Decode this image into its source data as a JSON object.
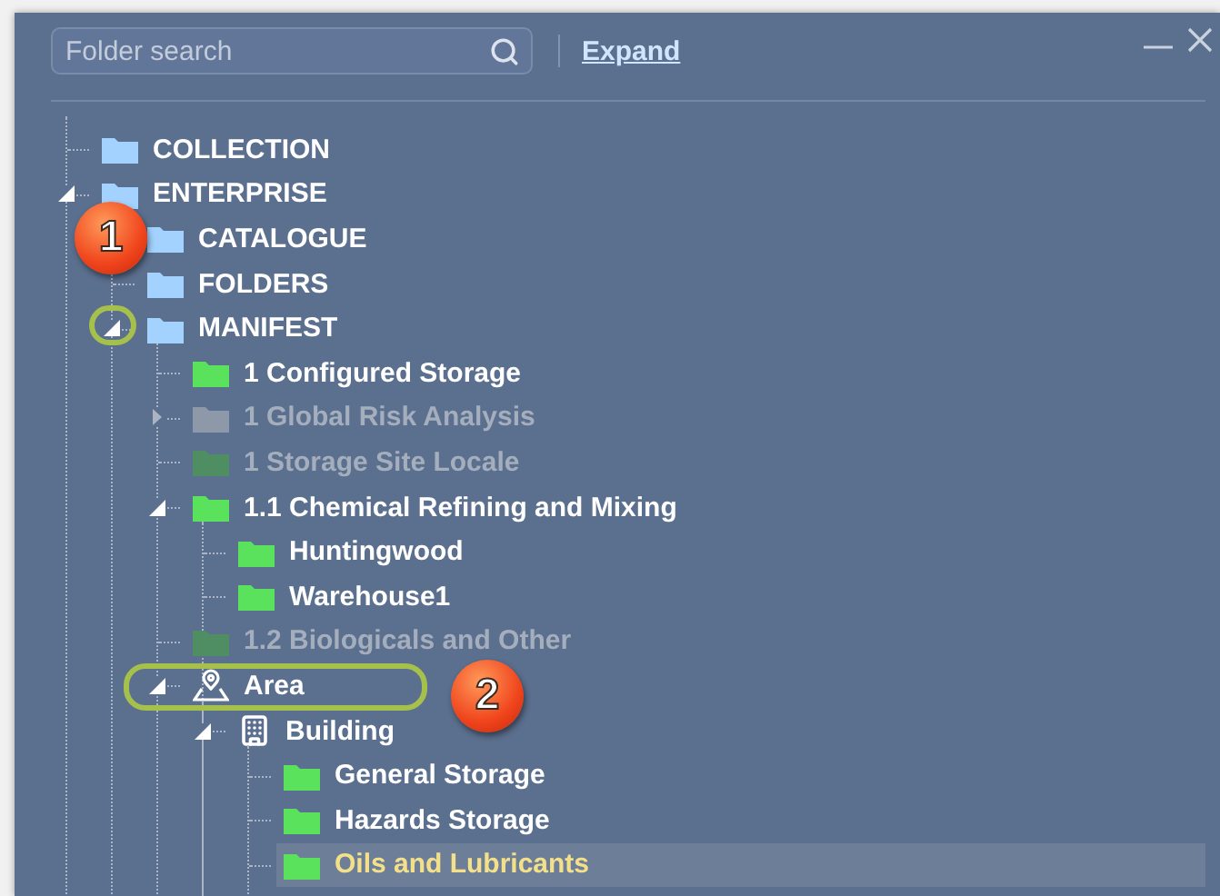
{
  "search": {
    "placeholder": "Folder search"
  },
  "expand_link": "Expand",
  "tree": [
    {
      "label": "COLLECTION",
      "kind": "folder",
      "color": "#a3d2ff",
      "disabled": false,
      "selected": false
    },
    {
      "label": "ENTERPRISE",
      "kind": "folder",
      "color": "#a3d2ff",
      "disabled": false,
      "selected": false,
      "expanded": true,
      "children": [
        {
          "label": "CATALOGUE",
          "kind": "folder",
          "color": "#a3d2ff",
          "disabled": false,
          "selected": false
        },
        {
          "label": "FOLDERS",
          "kind": "folder",
          "color": "#a3d2ff",
          "disabled": false,
          "selected": false
        },
        {
          "label": "MANIFEST",
          "kind": "folder",
          "color": "#a3d2ff",
          "disabled": false,
          "selected": false,
          "expanded": true,
          "children": [
            {
              "label": "1 Configured Storage",
              "kind": "folder",
              "color": "#5ae25c",
              "disabled": false,
              "selected": false
            },
            {
              "label": "1 Global Risk Analysis",
              "kind": "folder",
              "color": "#8d98a9",
              "disabled": true,
              "selected": false,
              "expanded": false
            },
            {
              "label": "1 Storage Site Locale",
              "kind": "folder",
              "color": "#4f8d62",
              "disabled": true,
              "selected": false
            },
            {
              "label": "1.1 Chemical Refining and Mixing",
              "kind": "folder",
              "color": "#5ae25c",
              "disabled": false,
              "selected": false,
              "expanded": true,
              "children": [
                {
                  "label": "Huntingwood",
                  "kind": "folder",
                  "color": "#5ae25c",
                  "disabled": false,
                  "selected": false
                },
                {
                  "label": "Warehouse1",
                  "kind": "folder",
                  "color": "#5ae25c",
                  "disabled": false,
                  "selected": false
                }
              ]
            },
            {
              "label": "1.2 Biologicals and Other",
              "kind": "folder",
              "color": "#4f8d62",
              "disabled": true,
              "selected": false
            },
            {
              "label": "Area",
              "kind": "area",
              "disabled": false,
              "selected": false,
              "expanded": true,
              "children": [
                {
                  "label": "Building",
                  "kind": "building",
                  "disabled": false,
                  "selected": false,
                  "expanded": true,
                  "children": [
                    {
                      "label": "General Storage",
                      "kind": "folder",
                      "color": "#5ae25c",
                      "disabled": false,
                      "selected": false
                    },
                    {
                      "label": "Hazards Storage",
                      "kind": "folder",
                      "color": "#5ae25c",
                      "disabled": false,
                      "selected": false
                    },
                    {
                      "label": "Oils and Lubricants",
                      "kind": "folder",
                      "color": "#5ae25c",
                      "disabled": false,
                      "selected": true
                    }
                  ]
                }
              ]
            }
          ]
        }
      ]
    }
  ],
  "callouts": [
    {
      "label": "1"
    },
    {
      "label": "2"
    }
  ]
}
